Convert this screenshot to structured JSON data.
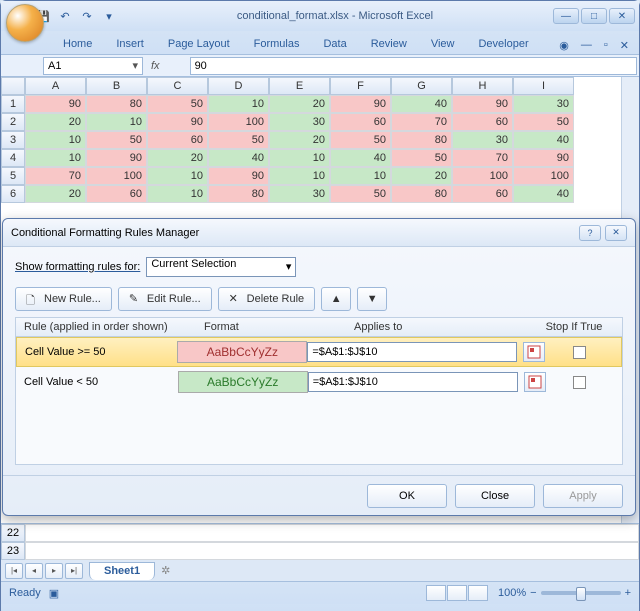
{
  "window": {
    "title": "conditional_format.xlsx - Microsoft Excel"
  },
  "ribbon": {
    "tabs": [
      "Home",
      "Insert",
      "Page Layout",
      "Formulas",
      "Data",
      "Review",
      "View",
      "Developer"
    ]
  },
  "namebox": "A1",
  "formula": "90",
  "columns": [
    "A",
    "B",
    "C",
    "D",
    "E",
    "F",
    "G",
    "H",
    "I"
  ],
  "rows": [
    "1",
    "2",
    "3",
    "4",
    "5",
    "6"
  ],
  "data": [
    [
      90,
      80,
      50,
      10,
      20,
      90,
      40,
      90,
      30
    ],
    [
      20,
      10,
      90,
      100,
      30,
      60,
      70,
      60,
      50
    ],
    [
      10,
      50,
      60,
      50,
      20,
      50,
      80,
      30,
      40
    ],
    [
      10,
      90,
      20,
      40,
      10,
      40,
      50,
      70,
      90
    ],
    [
      70,
      100,
      10,
      90,
      10,
      10,
      20,
      100,
      100
    ],
    [
      20,
      60,
      10,
      80,
      30,
      50,
      80,
      60,
      40
    ]
  ],
  "extra_rows": [
    "22",
    "23"
  ],
  "dialog": {
    "title": "Conditional Formatting Rules Manager",
    "show_label": "Show formatting rules for:",
    "show_value": "Current Selection",
    "new_rule": "New Rule...",
    "edit_rule": "Edit Rule...",
    "delete_rule": "Delete Rule",
    "hdr_rule": "Rule (applied in order shown)",
    "hdr_format": "Format",
    "hdr_applies": "Applies to",
    "hdr_stop": "Stop If True",
    "preview": "AaBbCcYyZz",
    "rules": [
      {
        "desc": "Cell Value >= 50",
        "cls": "hi",
        "range": "=$A$1:$J$10"
      },
      {
        "desc": "Cell Value < 50",
        "cls": "lo",
        "range": "=$A$1:$J$10"
      }
    ],
    "ok": "OK",
    "close": "Close",
    "apply": "Apply"
  },
  "sheet_tab": "Sheet1",
  "status": "Ready",
  "zoom": "100%"
}
